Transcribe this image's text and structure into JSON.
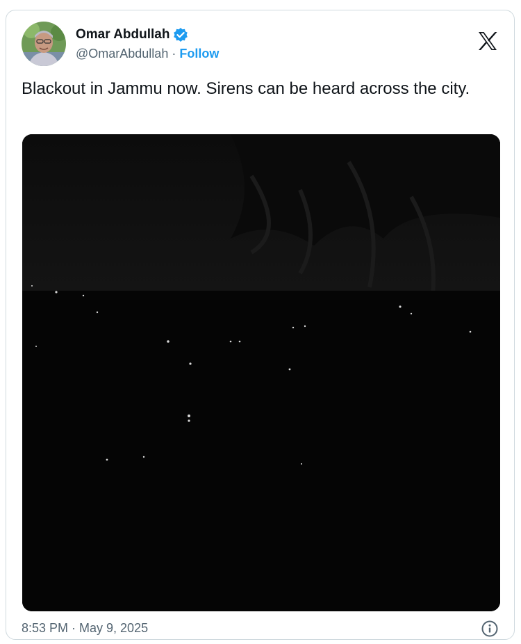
{
  "author": {
    "display_name": "Omar Abdullah",
    "handle": "@OmarAbdullah",
    "separator": "·",
    "follow_label": "Follow",
    "verified": true,
    "verified_color": "#1d9bf0"
  },
  "tweet": {
    "text": "Blackout in Jammu now. Sirens can be heard across the city.",
    "timestamp": "8:53 PM · May 9, 2025"
  },
  "icons": {
    "brand": "x-logo-icon",
    "verified": "verified-badge-icon",
    "info": "info-icon"
  },
  "colors": {
    "text": "#0f1419",
    "muted": "#536471",
    "accent": "#1d9bf0",
    "border": "#cfd9de"
  }
}
